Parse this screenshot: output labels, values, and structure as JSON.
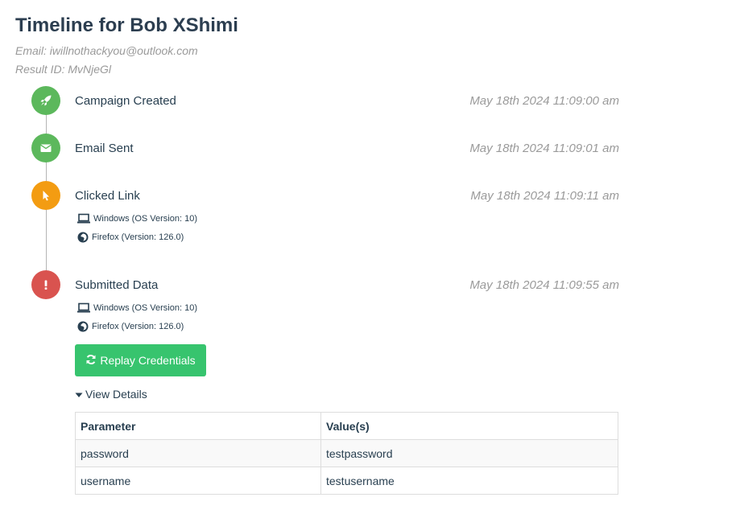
{
  "page": {
    "title": "Timeline for Bob XShimi",
    "email_line": "Email: iwillnothackyou@outlook.com",
    "result_line": "Result ID: MvNjeGl"
  },
  "colors": {
    "success": "#5cb85c",
    "warning": "#f39c12",
    "danger": "#d9534f",
    "replay_button": "#37c46e"
  },
  "events": [
    {
      "label": "Campaign Created",
      "time": "May 18th 2024 11:09:00 am",
      "icon": "rocket-icon",
      "color": "#5cb85c"
    },
    {
      "label": "Email Sent",
      "time": "May 18th 2024 11:09:01 am",
      "icon": "envelope-icon",
      "color": "#5cb85c"
    },
    {
      "label": "Clicked Link",
      "time": "May 18th 2024 11:09:11 am",
      "icon": "cursor-icon",
      "color": "#f39c12",
      "os": "Windows (OS Version: 10)",
      "browser": "Firefox (Version: 126.0)"
    },
    {
      "label": "Submitted Data",
      "time": "May 18th 2024 11:09:55 am",
      "icon": "exclamation-icon",
      "color": "#d9534f",
      "os": "Windows (OS Version: 10)",
      "browser": "Firefox (Version: 126.0)"
    }
  ],
  "replay_button": {
    "label": "Replay Credentials",
    "icon": "refresh-icon"
  },
  "view_details": {
    "label": "View Details",
    "icon": "caret-down-icon"
  },
  "params_table": {
    "headers": [
      "Parameter",
      "Value(s)"
    ],
    "rows": [
      [
        "password",
        "testpassword"
      ],
      [
        "username",
        "testusername"
      ]
    ]
  }
}
